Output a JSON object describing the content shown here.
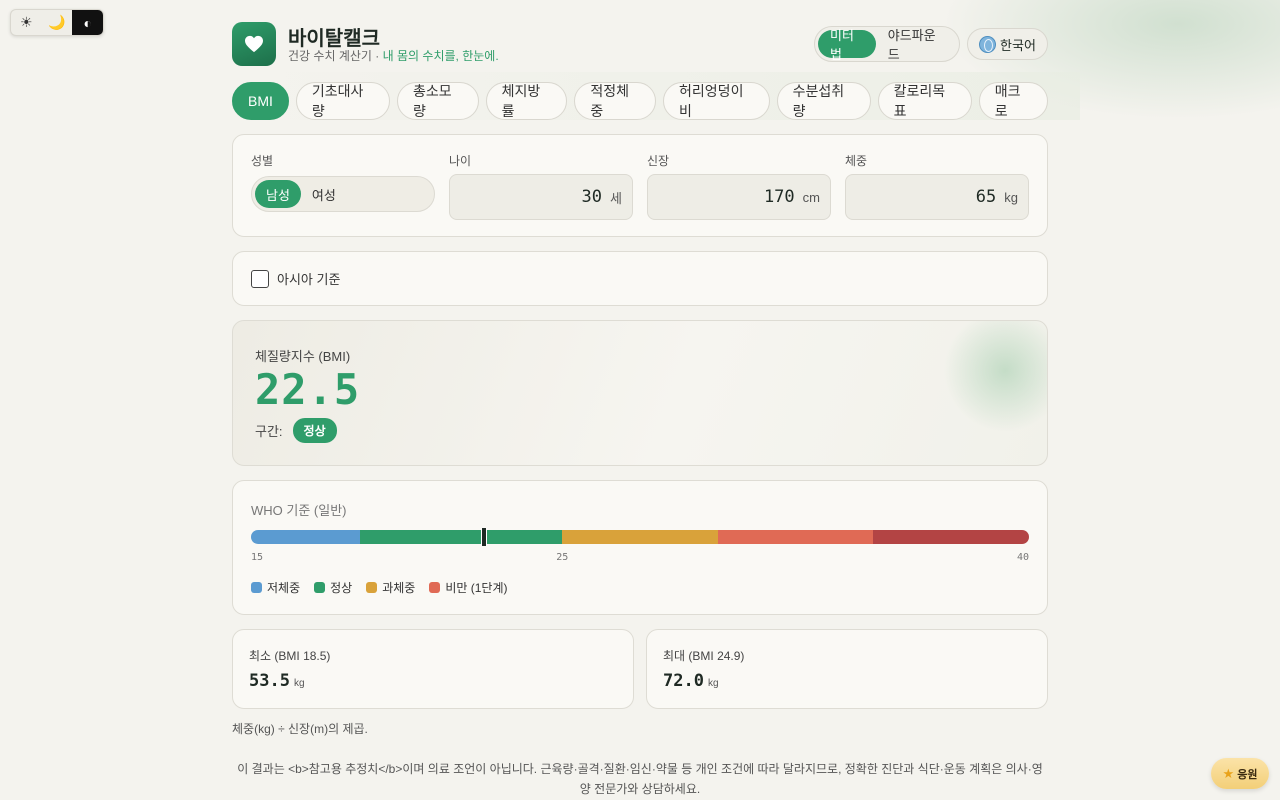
{
  "theme": {
    "light_icon": "sun-icon",
    "dark_icon": "moon-icon",
    "contrast_icon": "contrast-icon",
    "light_glyph": "☀",
    "dark_glyph": "🌙",
    "contrast_glyph": "◐",
    "active": "contrast"
  },
  "header": {
    "title": "바이탈캘크",
    "subtitle_prefix": "건강 수치 계산기 · ",
    "subtitle_accent": "내 몸의 수치를, 한눈에.",
    "units": [
      "미터법",
      "야드파운드"
    ],
    "active_unit": "미터법",
    "language": "한국어"
  },
  "tabs": [
    "BMI",
    "기초대사량",
    "총소모량",
    "체지방률",
    "적정체중",
    "허리엉덩이비",
    "수분섭취량",
    "칼로리목표",
    "매크로"
  ],
  "active_tab": "BMI",
  "inputs": {
    "gender": {
      "label": "성별",
      "options": [
        "남성",
        "여성"
      ],
      "selected": "남성"
    },
    "age": {
      "label": "나이",
      "value": "30",
      "unit": "세"
    },
    "height": {
      "label": "신장",
      "value": "170",
      "unit": "cm"
    },
    "weight": {
      "label": "체중",
      "value": "65",
      "unit": "kg"
    }
  },
  "asia": {
    "label": "아시아 기준",
    "checked": false
  },
  "result": {
    "label": "체질량지수 (BMI)",
    "value": "22.5",
    "category_label": "구간:",
    "category": "정상"
  },
  "scale": {
    "title": "WHO 기준 (일반)",
    "min": 15,
    "max": 40,
    "value": 22.5,
    "segments": [
      {
        "from": 15,
        "to": 18.5,
        "color": "#5b9bd1"
      },
      {
        "from": 18.5,
        "to": 25,
        "color": "#2f9d6a"
      },
      {
        "from": 25,
        "to": 30,
        "color": "#d9a23a"
      },
      {
        "from": 30,
        "to": 35,
        "color": "#e06a55"
      },
      {
        "from": 35,
        "to": 40,
        "color": "#b34444"
      }
    ],
    "ticks": [
      "15",
      "25",
      "40"
    ],
    "legend": [
      {
        "label": "저체중",
        "color": "#5b9bd1"
      },
      {
        "label": "정상",
        "color": "#2f9d6a"
      },
      {
        "label": "과체중",
        "color": "#d9a23a"
      },
      {
        "label": "비만 (1단계)",
        "color": "#e06a55"
      }
    ]
  },
  "range": {
    "min": {
      "label": "최소 (BMI 18.5)",
      "value": "53.5",
      "unit": "kg"
    },
    "max": {
      "label": "최대 (BMI 24.9)",
      "value": "72.0",
      "unit": "kg"
    }
  },
  "formula": "체중(kg) ÷ 신장(m)의 제곱.",
  "disclaimer": "이 결과는 <b>참고용 추정치</b>이며 의료 조언이 아닙니다. 근육량·골격·질환·임신·약물 등 개인 조건에 따라 달라지므로, 정확한 진단과 식단·운동 계획은 의사·영양 전문가와 상담하세요.",
  "support": {
    "label": "응원",
    "icon": "star-icon"
  },
  "colors": {
    "accent": "#2f9d6a",
    "background": "#f4f3ee"
  }
}
